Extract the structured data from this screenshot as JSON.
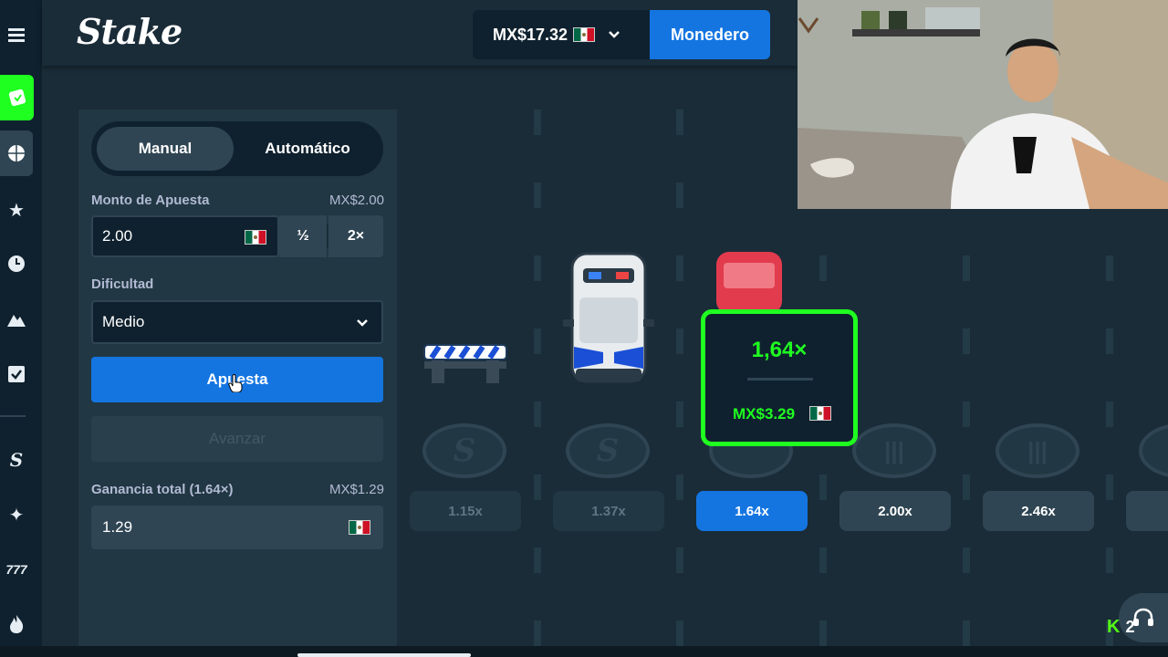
{
  "topbar": {
    "logo": "Stake",
    "balance": "MX$17.32",
    "wallet_label": "Monedero"
  },
  "sidebar": {
    "icons": [
      "menu-icon",
      "casino-icon",
      "sports-icon",
      "star-icon",
      "clock-icon",
      "mountain-icon",
      "checklist-icon",
      "stake-originals-icon",
      "sparkle-icon",
      "slots-777-icon",
      "fire-icon"
    ]
  },
  "panel": {
    "tabs": {
      "manual": "Manual",
      "auto": "Automático"
    },
    "bet": {
      "label": "Monto de Apuesta",
      "amount_display": "MX$2.00",
      "value": "2.00",
      "half": "½",
      "double": "2×"
    },
    "difficulty": {
      "label": "Dificultad",
      "value": "Medio"
    },
    "bet_button": "Apuesta",
    "advance_button": "Avanzar",
    "profit": {
      "label": "Ganancia total (1.64×)",
      "amount_display": "MX$1.29",
      "value": "1.29"
    }
  },
  "game": {
    "multipliers": [
      "1.15x",
      "1.37x",
      "1.64x",
      "2.00x",
      "2.46x"
    ],
    "active_index": 2,
    "cashout": {
      "multiplier": "1,64×",
      "amount": "MX$3.29"
    }
  },
  "overlay": {
    "kick_count": "2"
  },
  "colors": {
    "accent_green": "#1fff20",
    "primary_blue": "#1475e1",
    "bg_dark": "#0f212e",
    "bg_panel": "#213743",
    "bg_main": "#1a2c38"
  }
}
